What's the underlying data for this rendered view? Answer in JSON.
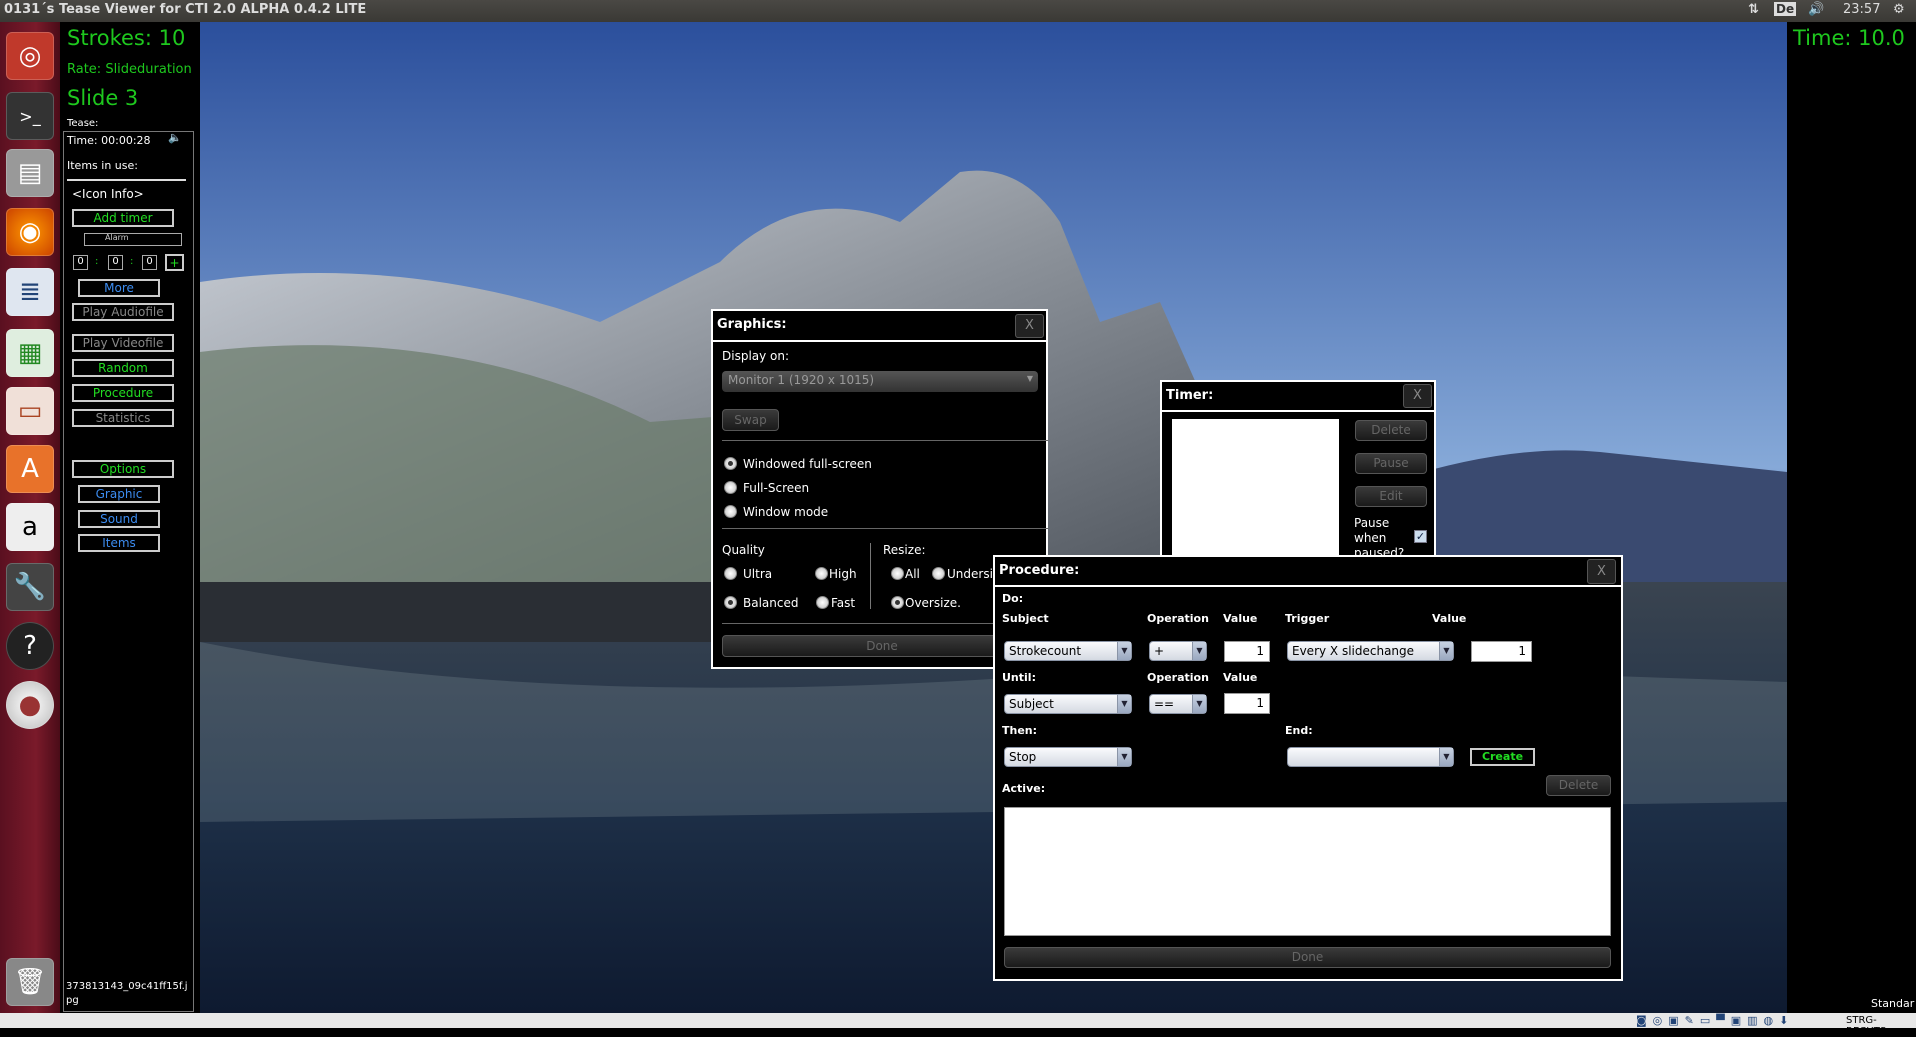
{
  "topbar": {
    "title": "0131´s Tease Viewer for CTI 2.0 ALPHA 0.4.2 LITE",
    "keyboard": "De",
    "clock": "23:57",
    "icons": [
      "network-arrows-icon",
      "keyboard-layout-icon",
      "volume-icon",
      "power-gear-icon"
    ]
  },
  "launcher": {
    "icons": [
      "ubuntu-dash-icon",
      "terminal-icon",
      "file-manager-icon",
      "firefox-icon",
      "writer-icon",
      "calc-icon",
      "impress-icon",
      "software-center-icon",
      "amazon-icon",
      "system-settings-icon",
      "tease-viewer-icon",
      "dvd-icon",
      "trash-icon"
    ]
  },
  "left": {
    "strokes": "Strokes: 10",
    "rate": "Rate: Slideduration",
    "slide": "Slide 3",
    "tease_label": "Tease:",
    "time": "Time: 00:00:28",
    "items_in_use": "Items in use:",
    "icon_info": "<Icon Info>",
    "add_timer": "Add timer",
    "alarm_placeholder": "Alarm",
    "spin": [
      "0",
      "0",
      "0"
    ],
    "sep": ":",
    "plus": "+",
    "more": "More",
    "play_audio": "Play Audiofile",
    "play_video": "Play Videofile",
    "random": "Random",
    "procedure": "Procedure",
    "statistics": "Statistics",
    "options": "Options",
    "graphic": "Graphic",
    "sound": "Sound",
    "items": "Items",
    "filename": "373813143_09c41ff15f.jpg"
  },
  "right": {
    "time": "Time: 10.0",
    "status": "Standar"
  },
  "graphics": {
    "title": "Graphics:",
    "close": "X",
    "display_on": "Display on:",
    "monitor": "Monitor 1 (1920 x 1015)",
    "swap": "Swap",
    "modes": [
      {
        "label": "Windowed full-screen",
        "selected": true
      },
      {
        "label": "Full-Screen",
        "selected": false
      },
      {
        "label": "Window mode",
        "selected": false
      }
    ],
    "quality_label": "Quality",
    "quality": [
      {
        "label": "Ultra",
        "selected": false
      },
      {
        "label": "High",
        "selected": false
      },
      {
        "label": "Balanced",
        "selected": true
      },
      {
        "label": "Fast",
        "selected": false
      }
    ],
    "resize_label": "Resize:",
    "resize": [
      {
        "label": "All",
        "selected": false
      },
      {
        "label": "Undersize",
        "selected": false
      },
      {
        "label": "Oversize.",
        "selected": true
      }
    ],
    "done": "Done"
  },
  "timer": {
    "title": "Timer:",
    "close": "X",
    "delete": "Delete",
    "pause": "Pause",
    "edit": "Edit",
    "pause_when": "Pause when paused?",
    "pause_checked": true
  },
  "procedure": {
    "title": "Procedure:",
    "close": "X",
    "do": "Do:",
    "h_subject": "Subject",
    "h_operation": "Operation",
    "h_value": "Value",
    "h_trigger": "Trigger",
    "h_value2": "Value",
    "subject": "Strokecount",
    "operation": "+",
    "value": "1",
    "trigger": "Every X slidechange",
    "trigger_value": "1",
    "until": "Until:",
    "until_op_label": "Operation",
    "until_value_label": "Value",
    "until_subject": "Subject",
    "until_op": "==",
    "until_value": "1",
    "then": "Then:",
    "then_value": "Stop",
    "end": "End:",
    "end_value": "",
    "create": "Create",
    "delete": "Delete",
    "active": "Active:",
    "done": "Done"
  },
  "statusbar": {
    "host_key": "STRG-RECHTS"
  },
  "colors": {
    "green": "#1ec81e",
    "blue": "#3c8cf0",
    "launcher": "#7a1a2a"
  }
}
